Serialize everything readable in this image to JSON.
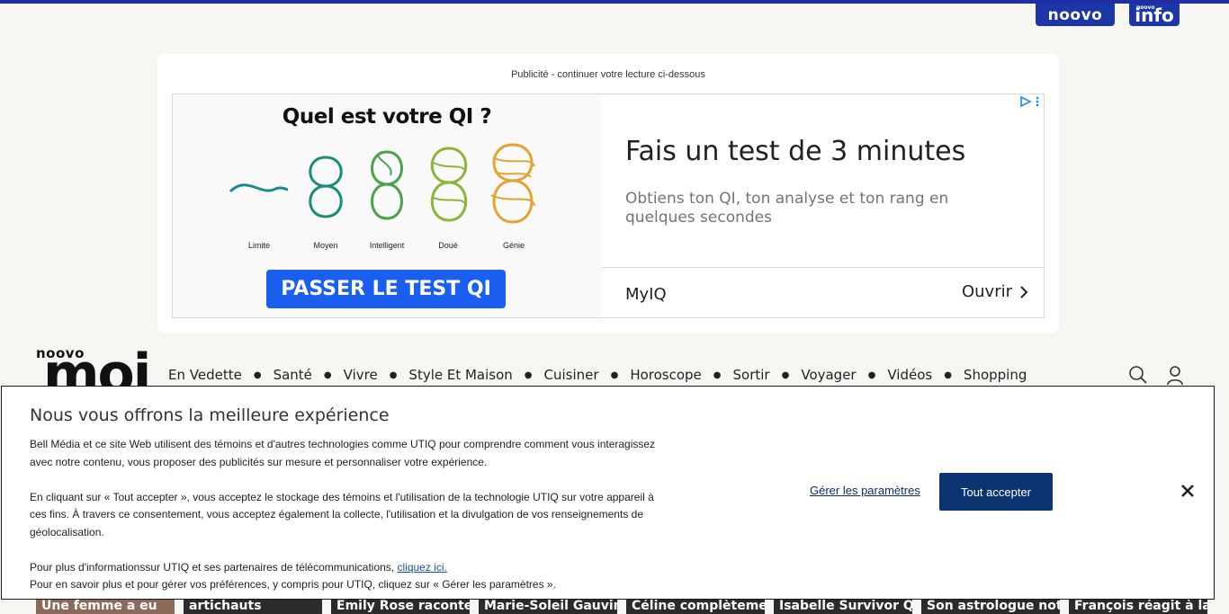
{
  "header": {
    "brand_noovo": "noovo",
    "brand_info_small": "noovo",
    "brand_info": "info"
  },
  "ad": {
    "label": "Publicité - continuer votre lecture ci-dessous",
    "question": "Quel est votre QI ?",
    "levels": [
      "Limite",
      "Moyen",
      "Intelligent",
      "Doué",
      "Génie"
    ],
    "cta": "PASSER LE TEST QI",
    "headline": "Fais un test de 3 minutes",
    "subtext": "Obtiens ton QI, ton analyse et ton rang en quelques secondes",
    "advertiser": "MyIQ",
    "open_label": "Ouvrir"
  },
  "site": {
    "logo_small": "noovo",
    "logo_big": "moi"
  },
  "nav": {
    "items": [
      "En Vedette",
      "Santé",
      "Vivre",
      "Style Et Maison",
      "Cuisiner",
      "Horoscope",
      "Sortir",
      "Voyager",
      "Vidéos",
      "Shopping"
    ]
  },
  "thumbs": {
    "items": [
      "Une femme a eu",
      "artichauts",
      "Emily Rose raconte sa",
      "Marie-Soleil Gauvin nous fait",
      "Céline complètement",
      "Isabelle Survivor Québec",
      "Son astrologue notre",
      "François réagit à la folie"
    ]
  },
  "consent": {
    "title": "Nous vous offrons la meilleure expérience",
    "p1": "Bell Média et ce site Web utilisent des témoins et d'autres technologies comme UTIQ pour comprendre comment vous interagissez avec notre contenu, vous proposer des publicités sur mesure et personnaliser votre expérience.",
    "p2": "En cliquant sur « Tout accepter », vous acceptez le stockage des témoins et l'utilisation de la technologie UTIQ sur votre appareil à ces fins. À travers ce consentement, vous acceptez également la collecte, l'utilisation et la divulgation de vos renseignements de géolocalisation.",
    "p3": "Pour plus d'informationssur UTIQ et ses partenaires de télécommunications,",
    "p3_link": "cliquez ici.",
    "p4": "Pour en savoir plus et pour gérer vos préférences, y compris pour UTIQ, cliquez sur « Gérer les paramètres ».",
    "manage_label": "Gérer les paramètres",
    "accept_label": "Tout accepter"
  },
  "colors": {
    "brand_blue": "#1c36a8",
    "cta_blue": "#1b5ff0",
    "accept_navy": "#0c3472"
  }
}
